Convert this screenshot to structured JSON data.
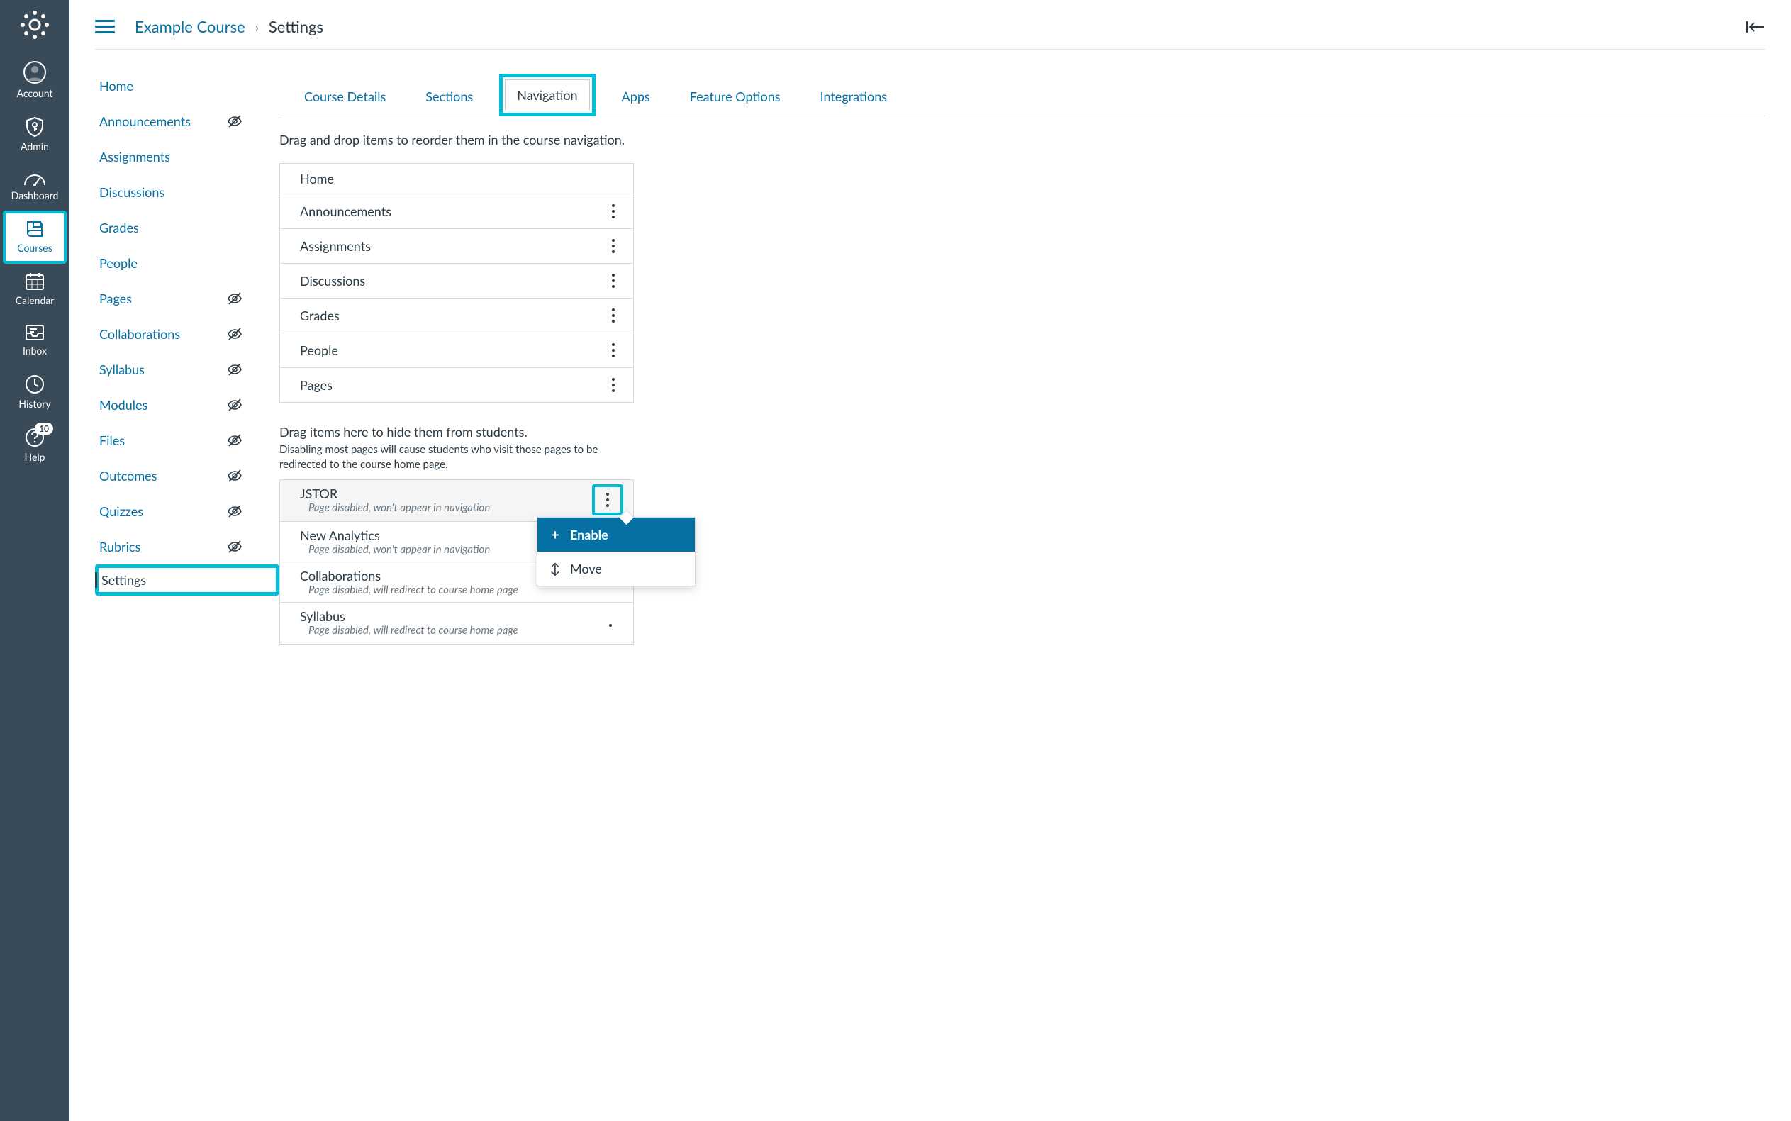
{
  "global_nav": {
    "items": [
      {
        "id": "account",
        "label": "Account",
        "icon": "user-circle"
      },
      {
        "id": "admin",
        "label": "Admin",
        "icon": "shield-key"
      },
      {
        "id": "dashboard",
        "label": "Dashboard",
        "icon": "speedometer"
      },
      {
        "id": "courses",
        "label": "Courses",
        "icon": "book",
        "highlighted": true
      },
      {
        "id": "calendar",
        "label": "Calendar",
        "icon": "calendar"
      },
      {
        "id": "inbox",
        "label": "Inbox",
        "icon": "inbox"
      },
      {
        "id": "history",
        "label": "History",
        "icon": "clock"
      },
      {
        "id": "help",
        "label": "Help",
        "icon": "help",
        "badge": "10"
      }
    ]
  },
  "breadcrumb": {
    "course": "Example Course",
    "current": "Settings"
  },
  "course_nav": [
    {
      "label": "Home"
    },
    {
      "label": "Announcements",
      "hidden": true
    },
    {
      "label": "Assignments"
    },
    {
      "label": "Discussions"
    },
    {
      "label": "Grades"
    },
    {
      "label": "People"
    },
    {
      "label": "Pages",
      "hidden": true
    },
    {
      "label": "Collaborations",
      "hidden": true
    },
    {
      "label": "Syllabus",
      "hidden": true
    },
    {
      "label": "Modules",
      "hidden": true
    },
    {
      "label": "Files",
      "hidden": true
    },
    {
      "label": "Outcomes",
      "hidden": true
    },
    {
      "label": "Quizzes",
      "hidden": true
    },
    {
      "label": "Rubrics",
      "hidden": true
    },
    {
      "label": "Settings",
      "active": true,
      "highlighted": true
    }
  ],
  "tabs": [
    {
      "label": "Course Details"
    },
    {
      "label": "Sections"
    },
    {
      "label": "Navigation",
      "active": true
    },
    {
      "label": "Apps"
    },
    {
      "label": "Feature Options"
    },
    {
      "label": "Integrations"
    }
  ],
  "nav_settings": {
    "instructions": "Drag and drop items to reorder them in the course navigation.",
    "enabled": [
      {
        "name": "Home",
        "no_options": true
      },
      {
        "name": "Announcements"
      },
      {
        "name": "Assignments"
      },
      {
        "name": "Discussions"
      },
      {
        "name": "Grades"
      },
      {
        "name": "People"
      },
      {
        "name": "Pages"
      }
    ],
    "hidden_header": "Drag items here to hide them from students.",
    "hidden_sub": "Disabling most pages will cause students who visit those pages to be redirected to the course home page.",
    "disabled": [
      {
        "name": "JSTOR",
        "desc": "Page disabled, won't appear in navigation",
        "highlighted": true,
        "menu_open": true
      },
      {
        "name": "New Analytics",
        "desc": "Page disabled, won't appear in navigation"
      },
      {
        "name": "Collaborations",
        "desc": "Page disabled, will redirect to course home page"
      },
      {
        "name": "Syllabus",
        "desc": "Page disabled, will redirect to course home page"
      }
    ],
    "menu": {
      "enable": "Enable",
      "move": "Move"
    }
  }
}
